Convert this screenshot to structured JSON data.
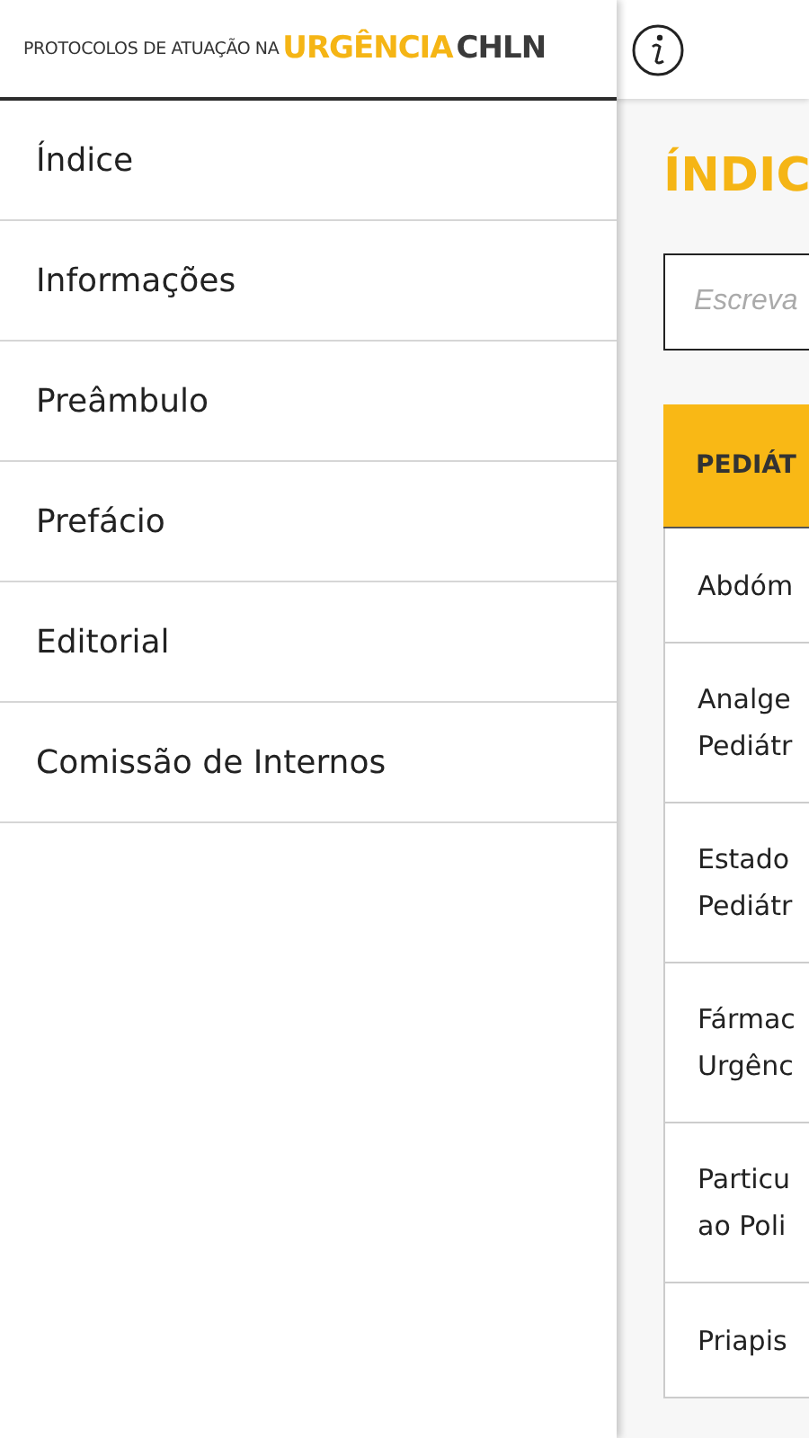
{
  "logo": {
    "prefix": "PROTOCOLOS DE ATUAÇÃO NA",
    "highlight": "URGÊNCIA",
    "suffix": "CHLN"
  },
  "drawer": {
    "items": [
      {
        "label": "Índice",
        "selected": false
      },
      {
        "label": "Informações",
        "selected": false
      },
      {
        "label": "Preâmbulo",
        "selected": false
      },
      {
        "label": "Prefácio",
        "selected": false
      },
      {
        "label": "Editorial",
        "selected": false
      },
      {
        "label": "Comissão de Internos",
        "selected": false
      }
    ]
  },
  "page": {
    "title": "ÍNDIC",
    "search": {
      "placeholder": "Escreva"
    },
    "table": {
      "header": "PEDIÁT",
      "rows": [
        {
          "lines": [
            "Abdóm"
          ]
        },
        {
          "lines": [
            "Analge",
            "Pediátr"
          ]
        },
        {
          "lines": [
            "Estado",
            "Pediátr"
          ]
        },
        {
          "lines": [
            "Fármac",
            "Urgênc"
          ]
        },
        {
          "lines": [
            "Particu",
            "ao Poli"
          ]
        },
        {
          "lines": [
            "Priapis"
          ]
        }
      ]
    }
  }
}
